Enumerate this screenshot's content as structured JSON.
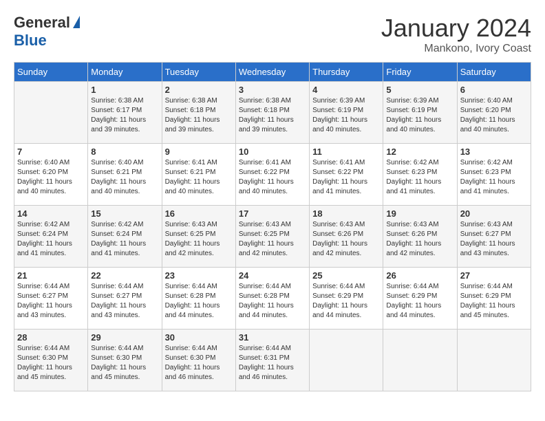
{
  "logo": {
    "general": "General",
    "blue": "Blue"
  },
  "title": "January 2024",
  "subtitle": "Mankono, Ivory Coast",
  "days_of_week": [
    "Sunday",
    "Monday",
    "Tuesday",
    "Wednesday",
    "Thursday",
    "Friday",
    "Saturday"
  ],
  "weeks": [
    [
      {
        "day": "",
        "sunrise": "",
        "sunset": "",
        "daylight": ""
      },
      {
        "day": "1",
        "sunrise": "Sunrise: 6:38 AM",
        "sunset": "Sunset: 6:17 PM",
        "daylight": "Daylight: 11 hours and 39 minutes."
      },
      {
        "day": "2",
        "sunrise": "Sunrise: 6:38 AM",
        "sunset": "Sunset: 6:18 PM",
        "daylight": "Daylight: 11 hours and 39 minutes."
      },
      {
        "day": "3",
        "sunrise": "Sunrise: 6:38 AM",
        "sunset": "Sunset: 6:18 PM",
        "daylight": "Daylight: 11 hours and 39 minutes."
      },
      {
        "day": "4",
        "sunrise": "Sunrise: 6:39 AM",
        "sunset": "Sunset: 6:19 PM",
        "daylight": "Daylight: 11 hours and 40 minutes."
      },
      {
        "day": "5",
        "sunrise": "Sunrise: 6:39 AM",
        "sunset": "Sunset: 6:19 PM",
        "daylight": "Daylight: 11 hours and 40 minutes."
      },
      {
        "day": "6",
        "sunrise": "Sunrise: 6:40 AM",
        "sunset": "Sunset: 6:20 PM",
        "daylight": "Daylight: 11 hours and 40 minutes."
      }
    ],
    [
      {
        "day": "7",
        "sunrise": "Sunrise: 6:40 AM",
        "sunset": "Sunset: 6:20 PM",
        "daylight": "Daylight: 11 hours and 40 minutes."
      },
      {
        "day": "8",
        "sunrise": "Sunrise: 6:40 AM",
        "sunset": "Sunset: 6:21 PM",
        "daylight": "Daylight: 11 hours and 40 minutes."
      },
      {
        "day": "9",
        "sunrise": "Sunrise: 6:41 AM",
        "sunset": "Sunset: 6:21 PM",
        "daylight": "Daylight: 11 hours and 40 minutes."
      },
      {
        "day": "10",
        "sunrise": "Sunrise: 6:41 AM",
        "sunset": "Sunset: 6:22 PM",
        "daylight": "Daylight: 11 hours and 40 minutes."
      },
      {
        "day": "11",
        "sunrise": "Sunrise: 6:41 AM",
        "sunset": "Sunset: 6:22 PM",
        "daylight": "Daylight: 11 hours and 41 minutes."
      },
      {
        "day": "12",
        "sunrise": "Sunrise: 6:42 AM",
        "sunset": "Sunset: 6:23 PM",
        "daylight": "Daylight: 11 hours and 41 minutes."
      },
      {
        "day": "13",
        "sunrise": "Sunrise: 6:42 AM",
        "sunset": "Sunset: 6:23 PM",
        "daylight": "Daylight: 11 hours and 41 minutes."
      }
    ],
    [
      {
        "day": "14",
        "sunrise": "Sunrise: 6:42 AM",
        "sunset": "Sunset: 6:24 PM",
        "daylight": "Daylight: 11 hours and 41 minutes."
      },
      {
        "day": "15",
        "sunrise": "Sunrise: 6:42 AM",
        "sunset": "Sunset: 6:24 PM",
        "daylight": "Daylight: 11 hours and 41 minutes."
      },
      {
        "day": "16",
        "sunrise": "Sunrise: 6:43 AM",
        "sunset": "Sunset: 6:25 PM",
        "daylight": "Daylight: 11 hours and 42 minutes."
      },
      {
        "day": "17",
        "sunrise": "Sunrise: 6:43 AM",
        "sunset": "Sunset: 6:25 PM",
        "daylight": "Daylight: 11 hours and 42 minutes."
      },
      {
        "day": "18",
        "sunrise": "Sunrise: 6:43 AM",
        "sunset": "Sunset: 6:26 PM",
        "daylight": "Daylight: 11 hours and 42 minutes."
      },
      {
        "day": "19",
        "sunrise": "Sunrise: 6:43 AM",
        "sunset": "Sunset: 6:26 PM",
        "daylight": "Daylight: 11 hours and 42 minutes."
      },
      {
        "day": "20",
        "sunrise": "Sunrise: 6:43 AM",
        "sunset": "Sunset: 6:27 PM",
        "daylight": "Daylight: 11 hours and 43 minutes."
      }
    ],
    [
      {
        "day": "21",
        "sunrise": "Sunrise: 6:44 AM",
        "sunset": "Sunset: 6:27 PM",
        "daylight": "Daylight: 11 hours and 43 minutes."
      },
      {
        "day": "22",
        "sunrise": "Sunrise: 6:44 AM",
        "sunset": "Sunset: 6:27 PM",
        "daylight": "Daylight: 11 hours and 43 minutes."
      },
      {
        "day": "23",
        "sunrise": "Sunrise: 6:44 AM",
        "sunset": "Sunset: 6:28 PM",
        "daylight": "Daylight: 11 hours and 44 minutes."
      },
      {
        "day": "24",
        "sunrise": "Sunrise: 6:44 AM",
        "sunset": "Sunset: 6:28 PM",
        "daylight": "Daylight: 11 hours and 44 minutes."
      },
      {
        "day": "25",
        "sunrise": "Sunrise: 6:44 AM",
        "sunset": "Sunset: 6:29 PM",
        "daylight": "Daylight: 11 hours and 44 minutes."
      },
      {
        "day": "26",
        "sunrise": "Sunrise: 6:44 AM",
        "sunset": "Sunset: 6:29 PM",
        "daylight": "Daylight: 11 hours and 44 minutes."
      },
      {
        "day": "27",
        "sunrise": "Sunrise: 6:44 AM",
        "sunset": "Sunset: 6:29 PM",
        "daylight": "Daylight: 11 hours and 45 minutes."
      }
    ],
    [
      {
        "day": "28",
        "sunrise": "Sunrise: 6:44 AM",
        "sunset": "Sunset: 6:30 PM",
        "daylight": "Daylight: 11 hours and 45 minutes."
      },
      {
        "day": "29",
        "sunrise": "Sunrise: 6:44 AM",
        "sunset": "Sunset: 6:30 PM",
        "daylight": "Daylight: 11 hours and 45 minutes."
      },
      {
        "day": "30",
        "sunrise": "Sunrise: 6:44 AM",
        "sunset": "Sunset: 6:30 PM",
        "daylight": "Daylight: 11 hours and 46 minutes."
      },
      {
        "day": "31",
        "sunrise": "Sunrise: 6:44 AM",
        "sunset": "Sunset: 6:31 PM",
        "daylight": "Daylight: 11 hours and 46 minutes."
      },
      {
        "day": "",
        "sunrise": "",
        "sunset": "",
        "daylight": ""
      },
      {
        "day": "",
        "sunrise": "",
        "sunset": "",
        "daylight": ""
      },
      {
        "day": "",
        "sunrise": "",
        "sunset": "",
        "daylight": ""
      }
    ]
  ]
}
